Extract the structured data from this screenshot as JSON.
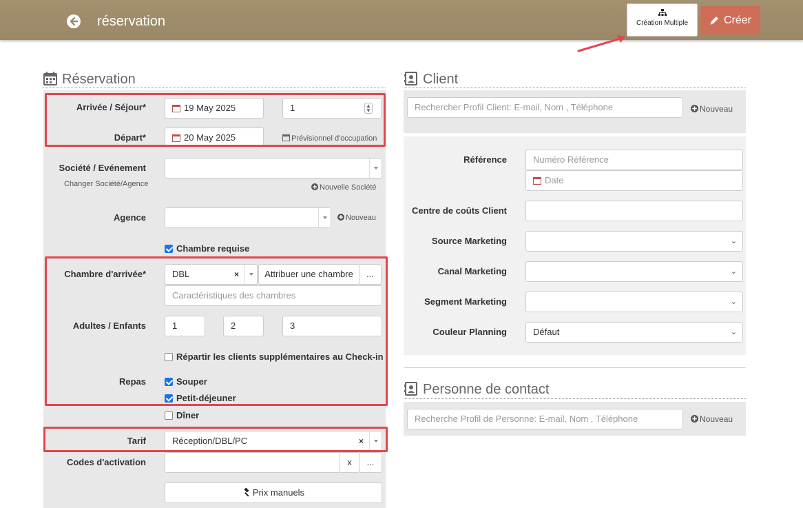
{
  "header": {
    "title": "réservation",
    "multi_label": "Création Multiple",
    "create_label": "Créer"
  },
  "reservation": {
    "section_title": "Réservation",
    "arrival_label": "Arrivée / Séjour*",
    "arrival_date": "19 May 2025",
    "nights": "1",
    "departure_label": "Départ*",
    "departure_date": "20 May 2025",
    "forecast_link": "Prévisionnel d'occupation",
    "company_label": "Société / Evénement",
    "change_company": "Changer Société/Agence",
    "new_company": "Nouvelle Société",
    "agency_label": "Agence",
    "agency_new": "Nouveau",
    "room_required": "Chambre requise",
    "arrival_room_label": "Chambre d'arrivée*",
    "room_type": "DBL",
    "clear_x": "×",
    "assign_room": "Attribuer une chambre",
    "more": "...",
    "room_features_ph": "Caractéristiques des chambres",
    "adults_label": "Adultes / Enfants",
    "adults": "1",
    "children1": "2",
    "children2": "3",
    "spread_label": "Répartir les clients supplémentaires au Check-in",
    "meals_label": "Repas",
    "meal_supper": "Souper",
    "meal_breakfast": "Petit-déjeuner",
    "meal_dinner": "Dîner",
    "rate_label": "Tarif",
    "rate_value": "Réception/DBL/PC",
    "activation_label": "Codes d'activation",
    "activation_x": "x",
    "manual_prices": "Prix manuels"
  },
  "client": {
    "section_title": "Client",
    "search_ph": "Rechercher Profil Client: E-mail, Nom , Téléphone",
    "new_label": "Nouveau",
    "reference_label": "Référence",
    "reference_ph": "Numéro Référence",
    "date_ph": "Date",
    "cost_center_label": "Centre de coûts Client",
    "source_label": "Source Marketing",
    "channel_label": "Canal Marketing",
    "segment_label": "Segment Marketing",
    "color_label": "Couleur Planning",
    "color_value": "Défaut"
  },
  "contact": {
    "section_title": "Personne de contact",
    "search_ph": "Recherche Profil de Personne: E-mail, Nom , Téléphone",
    "new_label": "Nouveau"
  },
  "checkboxes": {
    "room_required": true,
    "spread": false,
    "supper": true,
    "breakfast": true,
    "dinner": false
  },
  "colors": {
    "header_bg": "#9e8b6a",
    "create_button": "#cf6e57",
    "highlight_red": "#e0474c",
    "checkbox_blue": "#1a73e8"
  }
}
